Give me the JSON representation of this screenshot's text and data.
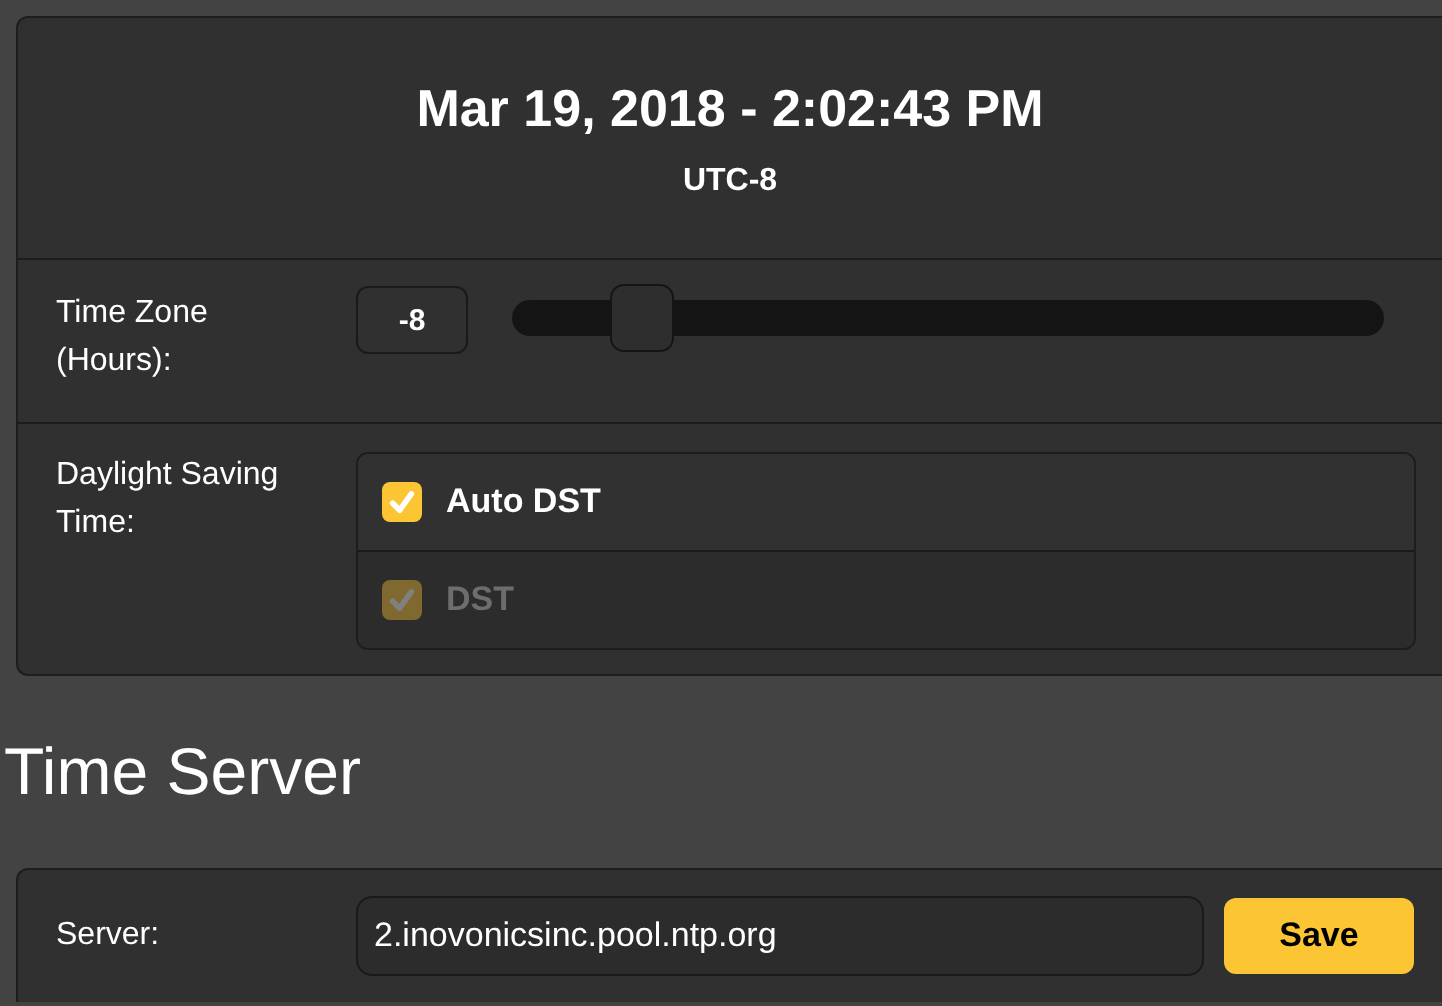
{
  "clock": {
    "datetime": "Mar 19, 2018 - 2:02:43 PM",
    "zone": "UTC-8"
  },
  "time_zone": {
    "label": "Time Zone (Hours):",
    "value": "-8",
    "level": 0.15
  },
  "dst": {
    "label": "Daylight Saving Time:",
    "options": [
      {
        "label": "Auto DST",
        "checked": true,
        "disabled": false
      },
      {
        "label": "DST",
        "checked": true,
        "disabled": true
      }
    ]
  },
  "time_server": {
    "heading": "Time Server",
    "label": "Server:",
    "value": "2.inovonicsinc.pool.ntp.org",
    "button": "Save"
  }
}
